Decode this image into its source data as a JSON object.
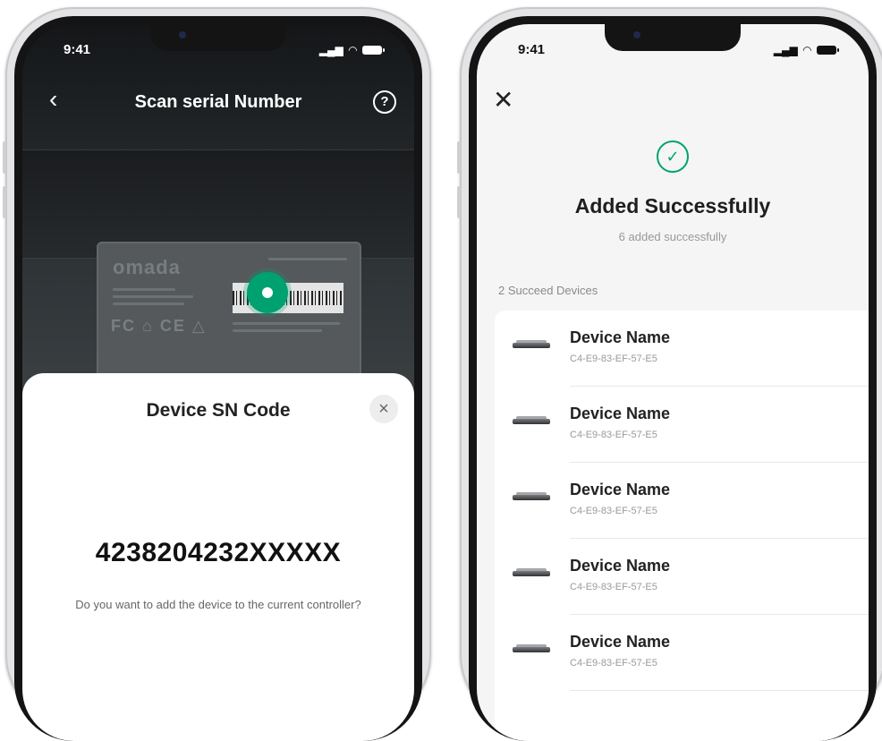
{
  "left_screen": {
    "status_time": "9:41",
    "nav": {
      "back_icon": "chevron-left-icon",
      "title": "Scan serial Number",
      "help_icon": "help-circle-icon"
    },
    "device_label": {
      "brand": "omada"
    },
    "sheet": {
      "title": "Device SN Code",
      "close_icon": "close-icon",
      "sn_code": "4238204232XXXXX",
      "question": "Do you want to add the device to the current controller?"
    }
  },
  "right_screen": {
    "status_time": "9:41",
    "close_icon": "close-icon",
    "success_icon": "check-circle-icon",
    "title": "Added Successfully",
    "subtitle": "6 added successfully",
    "list_caption": "2 Succeed Devices",
    "devices": [
      {
        "name": "Device Name",
        "mac": "C4-E9-83-EF-57-E5"
      },
      {
        "name": "Device Name",
        "mac": "C4-E9-83-EF-57-E5"
      },
      {
        "name": "Device Name",
        "mac": "C4-E9-83-EF-57-E5"
      },
      {
        "name": "Device Name",
        "mac": "C4-E9-83-EF-57-E5"
      },
      {
        "name": "Device Name",
        "mac": "C4-E9-83-EF-57-E5"
      }
    ]
  },
  "colors": {
    "accent": "#00a170",
    "dark_bg": "#1b1d1f",
    "light_bg": "#f5f5f5"
  }
}
